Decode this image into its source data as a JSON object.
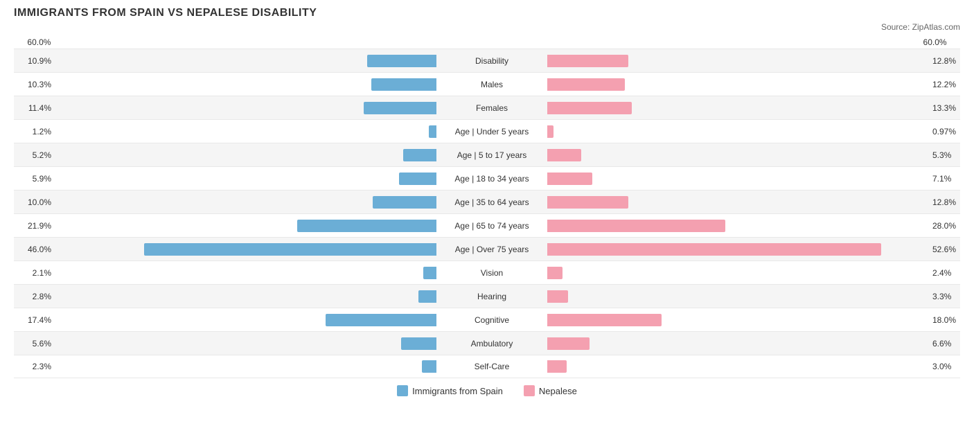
{
  "title": "IMMIGRANTS FROM SPAIN VS NEPALESE DISABILITY",
  "source": "Source: ZipAtlas.com",
  "maxPercent": 60,
  "barMaxWidth": 550,
  "legend": {
    "left": {
      "label": "Immigrants from Spain",
      "color": "#6baed6"
    },
    "right": {
      "label": "Nepalese",
      "color": "#f4a0b0"
    }
  },
  "xAxis": {
    "left": "60.0%",
    "right": "60.0%"
  },
  "rows": [
    {
      "label": "Disability",
      "leftVal": "10.9%",
      "leftPct": 10.9,
      "rightVal": "12.8%",
      "rightPct": 12.8
    },
    {
      "label": "Males",
      "leftVal": "10.3%",
      "leftPct": 10.3,
      "rightVal": "12.2%",
      "rightPct": 12.2
    },
    {
      "label": "Females",
      "leftVal": "11.4%",
      "leftPct": 11.4,
      "rightVal": "13.3%",
      "rightPct": 13.3
    },
    {
      "label": "Age | Under 5 years",
      "leftVal": "1.2%",
      "leftPct": 1.2,
      "rightVal": "0.97%",
      "rightPct": 0.97
    },
    {
      "label": "Age | 5 to 17 years",
      "leftVal": "5.2%",
      "leftPct": 5.2,
      "rightVal": "5.3%",
      "rightPct": 5.3
    },
    {
      "label": "Age | 18 to 34 years",
      "leftVal": "5.9%",
      "leftPct": 5.9,
      "rightVal": "7.1%",
      "rightPct": 7.1
    },
    {
      "label": "Age | 35 to 64 years",
      "leftVal": "10.0%",
      "leftPct": 10.0,
      "rightVal": "12.8%",
      "rightPct": 12.8
    },
    {
      "label": "Age | 65 to 74 years",
      "leftVal": "21.9%",
      "leftPct": 21.9,
      "rightVal": "28.0%",
      "rightPct": 28.0
    },
    {
      "label": "Age | Over 75 years",
      "leftVal": "46.0%",
      "leftPct": 46.0,
      "rightVal": "52.6%",
      "rightPct": 52.6
    },
    {
      "label": "Vision",
      "leftVal": "2.1%",
      "leftPct": 2.1,
      "rightVal": "2.4%",
      "rightPct": 2.4
    },
    {
      "label": "Hearing",
      "leftVal": "2.8%",
      "leftPct": 2.8,
      "rightVal": "3.3%",
      "rightPct": 3.3
    },
    {
      "label": "Cognitive",
      "leftVal": "17.4%",
      "leftPct": 17.4,
      "rightVal": "18.0%",
      "rightPct": 18.0
    },
    {
      "label": "Ambulatory",
      "leftVal": "5.6%",
      "leftPct": 5.6,
      "rightVal": "6.6%",
      "rightPct": 6.6
    },
    {
      "label": "Self-Care",
      "leftVal": "2.3%",
      "leftPct": 2.3,
      "rightVal": "3.0%",
      "rightPct": 3.0
    }
  ]
}
